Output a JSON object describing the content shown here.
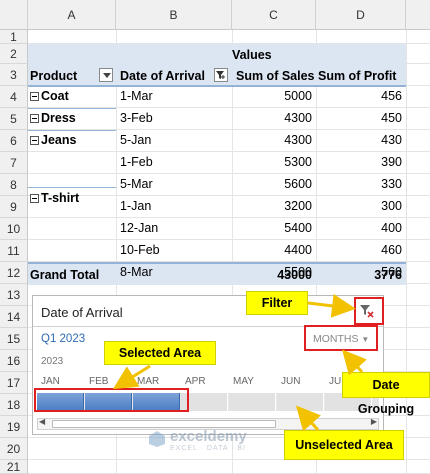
{
  "columns": [
    "A",
    "B",
    "C",
    "D"
  ],
  "rows": [
    "1",
    "2",
    "3",
    "4",
    "5",
    "6",
    "7",
    "8",
    "9",
    "10",
    "11",
    "12",
    "13",
    "14",
    "15",
    "16",
    "17",
    "18",
    "19",
    "20",
    "21"
  ],
  "pivot": {
    "values_label": "Values",
    "headers": {
      "product": "Product",
      "date": "Date of Arrival",
      "sales": "Sum of Sales",
      "profit": "Sum of Profit"
    },
    "groups": [
      {
        "product": "Coat",
        "rows": [
          {
            "date": "1-Mar",
            "sales": "5000",
            "profit": "456"
          }
        ]
      },
      {
        "product": "Dress",
        "rows": [
          {
            "date": "3-Feb",
            "sales": "4300",
            "profit": "450"
          }
        ]
      },
      {
        "product": "Jeans",
        "rows": [
          {
            "date": "5-Jan",
            "sales": "4300",
            "profit": "430"
          },
          {
            "date": "1-Feb",
            "sales": "5300",
            "profit": "390"
          },
          {
            "date": "5-Mar",
            "sales": "5600",
            "profit": "330"
          }
        ]
      },
      {
        "product": "T-shirt",
        "rows": [
          {
            "date": "1-Jan",
            "sales": "3200",
            "profit": "300"
          },
          {
            "date": "12-Jan",
            "sales": "5400",
            "profit": "400"
          },
          {
            "date": "10-Feb",
            "sales": "4400",
            "profit": "460"
          },
          {
            "date": "8-Mar",
            "sales": "5500",
            "profit": "560"
          }
        ]
      }
    ],
    "grand_total": {
      "label": "Grand Total",
      "sales": "43000",
      "profit": "3776"
    }
  },
  "timeline": {
    "title": "Date of Arrival",
    "period": "Q1 2023",
    "year": "2023",
    "grouping": "MONTHS",
    "months": [
      "JAN",
      "FEB",
      "MAR",
      "APR",
      "MAY",
      "JUN",
      "JUL"
    ],
    "selected_months": 3
  },
  "callouts": {
    "filter": "Filter",
    "selected": "Selected Area",
    "grouping": "Date Grouping",
    "unselected": "Unselected Area"
  },
  "watermark": {
    "brand": "exceldemy",
    "tagline": "EXCEL · DATA · BI"
  }
}
